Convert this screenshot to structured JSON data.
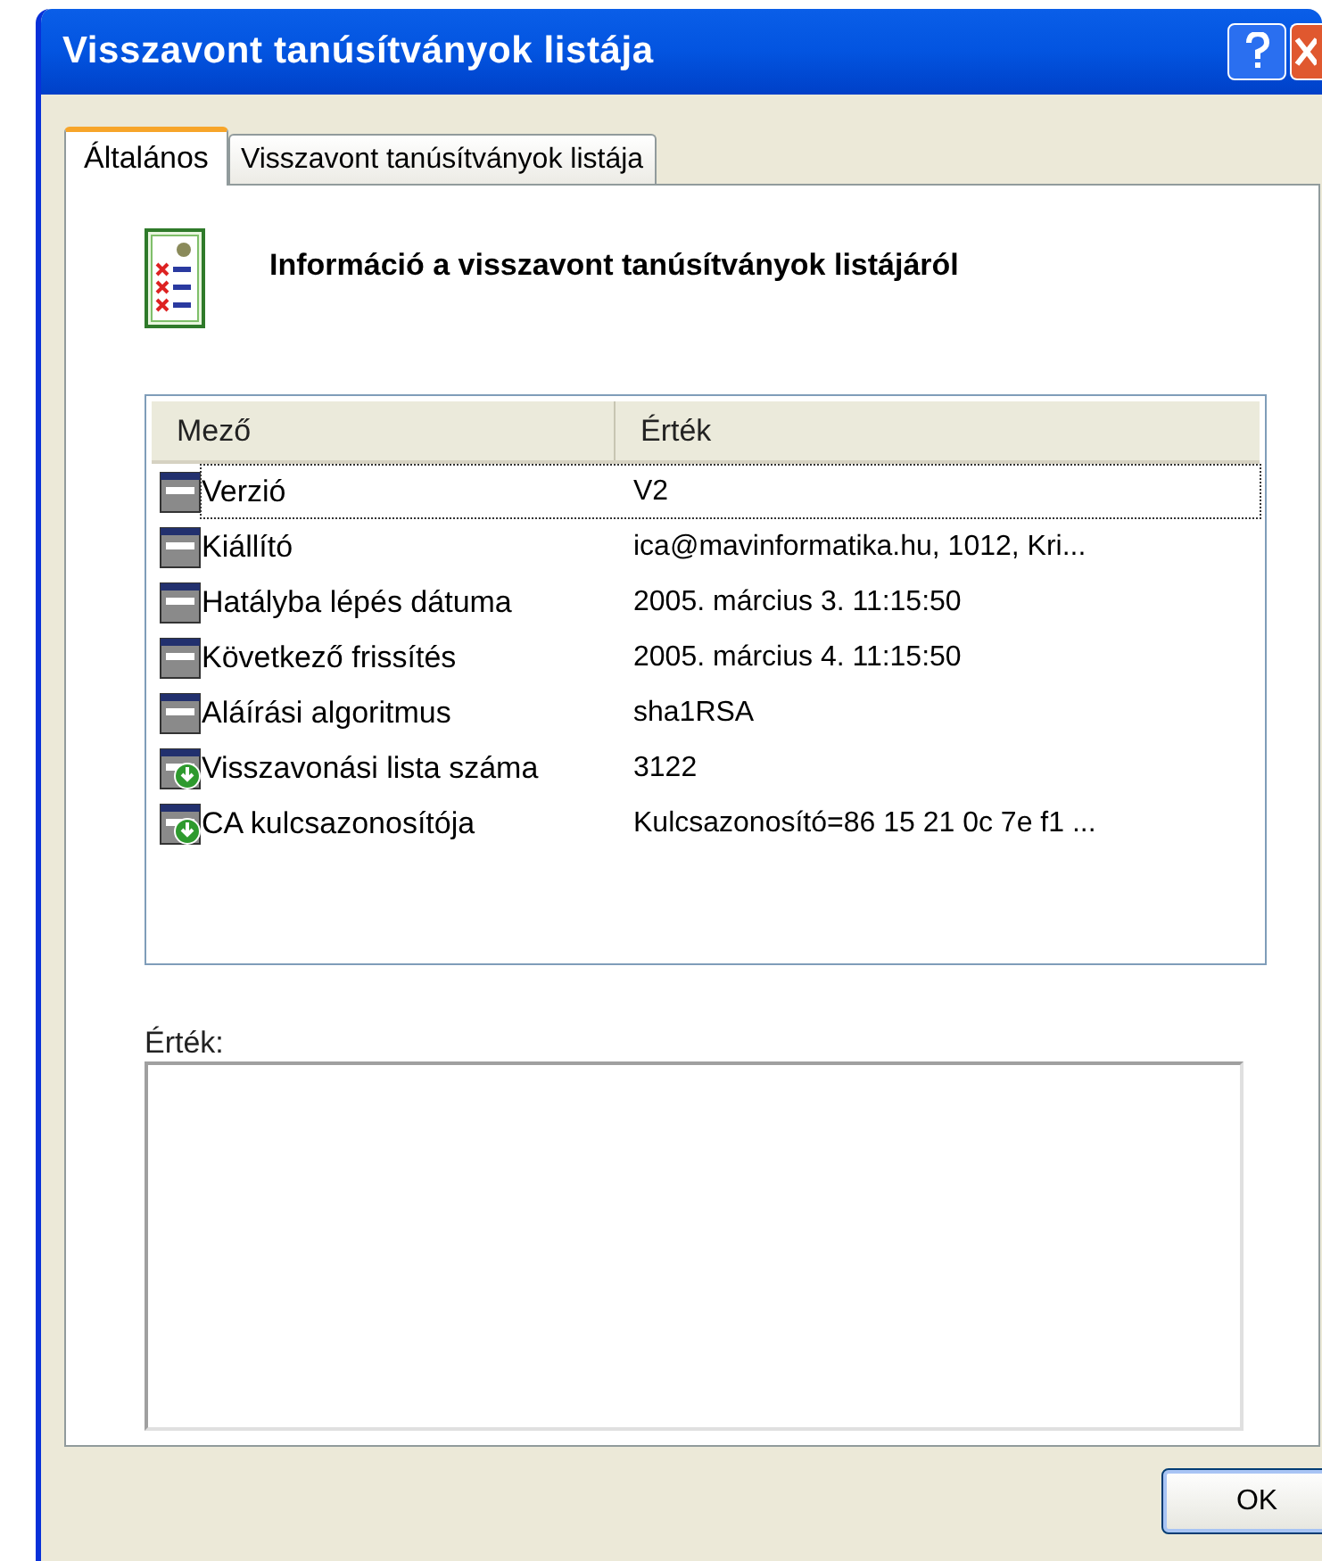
{
  "window": {
    "title": "Visszavont tanúsítványok listája"
  },
  "tabs": [
    {
      "label": "Általános",
      "selected": true
    },
    {
      "label": "Visszavont tanúsítványok listája",
      "selected": false
    }
  ],
  "heading": "Információ a visszavont tanúsítványok listájáról",
  "table": {
    "columns": [
      "Mező",
      "Érték"
    ],
    "rows": [
      {
        "kind": "field",
        "field": "Verzió",
        "value": "V2",
        "focused": true
      },
      {
        "kind": "field",
        "field": "Kiállító",
        "value": "ica@mavinformatika.hu, 1012, Kri...",
        "focused": false
      },
      {
        "kind": "field",
        "field": "Hatályba lépés dátuma",
        "value": "2005. március 3. 11:15:50",
        "focused": false
      },
      {
        "kind": "field",
        "field": "Következő frissítés",
        "value": "2005. március 4. 11:15:50",
        "focused": false
      },
      {
        "kind": "field",
        "field": "Aláírási algoritmus",
        "value": "sha1RSA",
        "focused": false
      },
      {
        "kind": "extension",
        "field": "Visszavonási lista száma",
        "value": "3122",
        "focused": false
      },
      {
        "kind": "extension",
        "field": "CA kulcsazonosítója",
        "value": "Kulcsazonosító=86 15 21 0c 7e f1 ...",
        "focused": false
      }
    ]
  },
  "value_label": "Érték:",
  "buttons": [
    "OK"
  ]
}
